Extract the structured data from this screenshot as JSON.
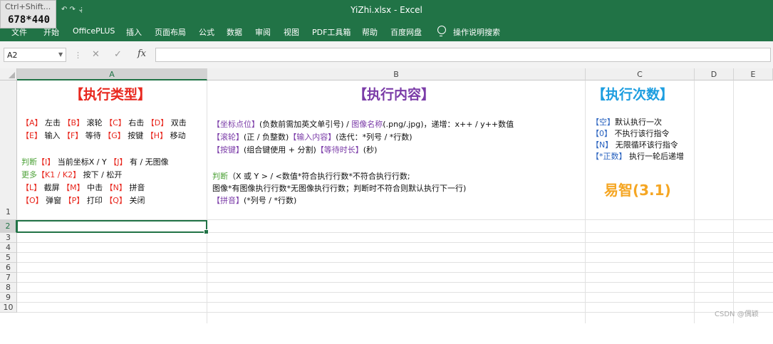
{
  "window": {
    "title": "YiZhi.xlsx  -  Excel"
  },
  "overlay": {
    "hint": "Ctrl+Shift...",
    "size_readout": "678*440"
  },
  "quick_access": {
    "undo_redo": "↶ ↷ ⌄",
    "customize": "⫶"
  },
  "menu": {
    "items": [
      "文件",
      "开始",
      "OfficePLUS",
      "插入",
      "页面布局",
      "公式",
      "数据",
      "审阅",
      "视图",
      "PDF工具箱",
      "帮助",
      "百度网盘"
    ],
    "tell_me": "操作说明搜索"
  },
  "formula_bar": {
    "name_box": "A2",
    "cancel": "✕",
    "enter": "✓",
    "fx": "fx",
    "value": ""
  },
  "columns": [
    "A",
    "B",
    "C",
    "D",
    "E"
  ],
  "rows": [
    "1",
    "2",
    "3",
    "4",
    "5",
    "6",
    "7",
    "8",
    "9",
    "10"
  ],
  "cells": {
    "a1": {
      "title": "【执行类型】",
      "line1": [
        [
          "【A】",
          "r"
        ],
        [
          " 左击 ",
          ""
        ],
        [
          "【B】",
          "r"
        ],
        [
          " 滚轮 ",
          ""
        ],
        [
          "【C】",
          "r"
        ],
        [
          " 右击 ",
          ""
        ],
        [
          "【D】",
          "r"
        ],
        [
          " 双击",
          ""
        ]
      ],
      "line2": [
        [
          "【E】",
          "r"
        ],
        [
          " 输入 ",
          ""
        ],
        [
          "【F】",
          "r"
        ],
        [
          " 等待 ",
          ""
        ],
        [
          "【G】",
          "r"
        ],
        [
          " 按键 ",
          ""
        ],
        [
          "【H】",
          "r"
        ],
        [
          " 移动",
          ""
        ]
      ],
      "line3": [
        [
          "判断",
          "g"
        ],
        [
          "【I】",
          "r"
        ],
        [
          " 当前坐标X / Y ",
          ""
        ],
        [
          "【J】",
          "r"
        ],
        [
          " 有 / 无图像",
          ""
        ]
      ],
      "line4": [
        [
          "更多",
          "g"
        ],
        [
          "【K1 / K2】",
          "r"
        ],
        [
          " 按下 / 松开",
          ""
        ]
      ],
      "line5": [
        [
          "【L】",
          "r"
        ],
        [
          " 截屏 ",
          ""
        ],
        [
          "【M】",
          "r"
        ],
        [
          " 中击 ",
          ""
        ],
        [
          "【N】",
          "r"
        ],
        [
          " 拼音",
          ""
        ]
      ],
      "line6": [
        [
          "【O】",
          "r"
        ],
        [
          " 弹窗 ",
          ""
        ],
        [
          "【P】",
          "r"
        ],
        [
          " 打印 ",
          ""
        ],
        [
          "【Q】",
          "r"
        ],
        [
          " 关闭",
          ""
        ]
      ]
    },
    "b1": {
      "title": "【执行内容】",
      "line1": [
        [
          "【坐标点位】",
          "p"
        ],
        [
          "(负数前需加英文单引号) / ",
          ""
        ],
        [
          "图像名称",
          "p"
        ],
        [
          "(.png/.jpg)，递增：x++ / y++数值",
          ""
        ]
      ],
      "line2": [
        [
          "【滚轮】",
          "p"
        ],
        [
          "(正 / 负整数)",
          ""
        ],
        [
          "【输入内容】",
          "p"
        ],
        [
          "(迭代：*列号 / *行数)",
          ""
        ]
      ],
      "line3": [
        [
          "【按键】",
          "p"
        ],
        [
          "(组合键使用 + 分割)",
          ""
        ],
        [
          "【等待时长】",
          "p"
        ],
        [
          "(秒)",
          ""
        ]
      ],
      "line4": [
        [
          "判断",
          "g"
        ],
        [
          "（X 或 Y > / <数值*符合执行行数*不符合执行行数;",
          ""
        ]
      ],
      "line5": [
        [
          "图像*有图像执行行数*无图像执行行数；判断时不符合则默认执行下一行)",
          ""
        ]
      ],
      "line6": [
        [
          "【拼音】",
          "p"
        ],
        [
          "(*列号 / *行数)",
          ""
        ]
      ]
    },
    "c1": {
      "title": "【执行次数】",
      "line1": [
        [
          "【空】",
          "b"
        ],
        [
          "默认执行一次",
          ""
        ]
      ],
      "line2": [
        [
          "【0】",
          "b"
        ],
        [
          " 不执行该行指令",
          ""
        ]
      ],
      "line3": [
        [
          "【N】",
          "b"
        ],
        [
          " 无限循环该行指令",
          ""
        ]
      ],
      "line4": [
        [
          "【*正数】",
          "b"
        ],
        [
          " 执行一轮后递增",
          ""
        ]
      ],
      "brand": "易智(3.1)"
    }
  },
  "watermark": "CSDN @偶颖",
  "colors": {
    "excel_green": "#217346",
    "red": "#e8281f",
    "purple": "#7b3ca8",
    "blue": "#2b64c0",
    "green": "#4fa33a",
    "orange": "#f5a623"
  }
}
